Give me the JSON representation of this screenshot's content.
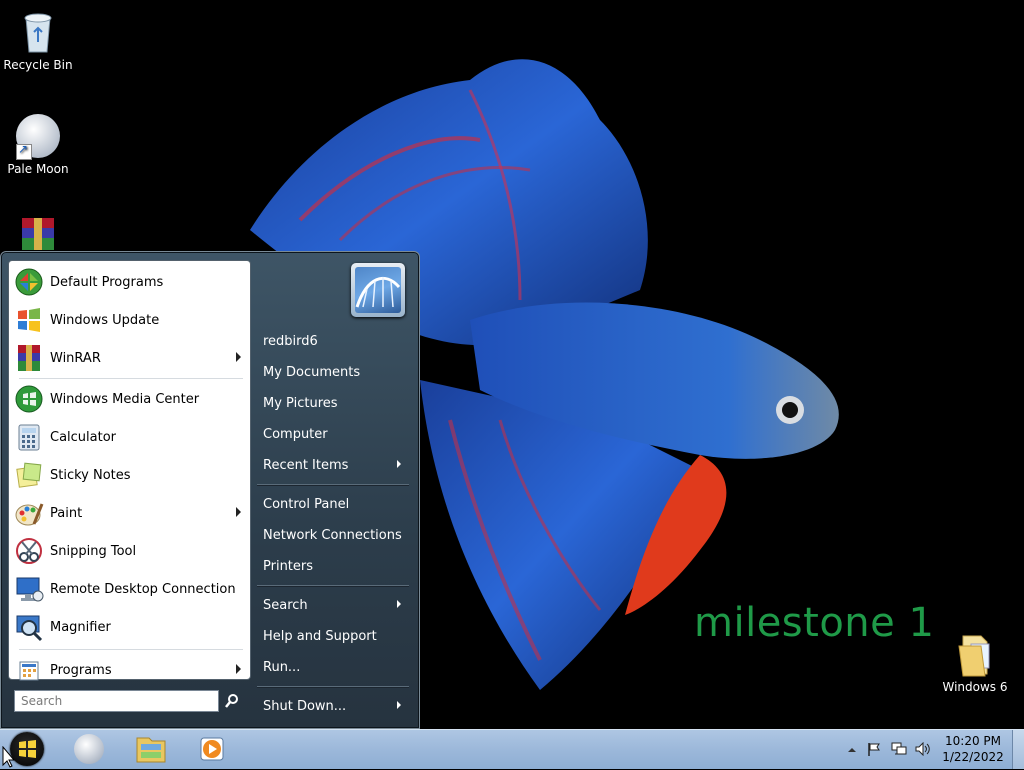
{
  "desktop": {
    "icons": [
      {
        "label": "Recycle Bin",
        "icon": "recycle-bin-icon"
      },
      {
        "label": "Pale Moon",
        "icon": "pale-moon-icon"
      },
      {
        "label": "",
        "icon": "winrar-icon"
      },
      {
        "label": "Windows 6",
        "icon": "folder-icon"
      }
    ],
    "watermark": "milestone 1"
  },
  "start_menu": {
    "programs": [
      {
        "label": "Default Programs",
        "icon": "default-programs-icon",
        "submenu": false
      },
      {
        "label": "Windows Update",
        "icon": "windows-update-icon",
        "submenu": false
      },
      {
        "label": "WinRAR",
        "icon": "winrar-icon",
        "submenu": true
      },
      {
        "label": "Windows Media Center",
        "icon": "media-center-icon",
        "submenu": false
      },
      {
        "label": "Calculator",
        "icon": "calculator-icon",
        "submenu": false
      },
      {
        "label": "Sticky Notes",
        "icon": "sticky-notes-icon",
        "submenu": false
      },
      {
        "label": "Paint",
        "icon": "paint-icon",
        "submenu": true
      },
      {
        "label": "Snipping Tool",
        "icon": "snipping-tool-icon",
        "submenu": false
      },
      {
        "label": "Remote Desktop Connection",
        "icon": "remote-desktop-icon",
        "submenu": false
      },
      {
        "label": "Magnifier",
        "icon": "magnifier-icon",
        "submenu": false
      }
    ],
    "all_programs_label": "Programs",
    "search_placeholder": "Search",
    "right_items": [
      {
        "label": "redbird6",
        "submenu": false
      },
      {
        "label": "My Documents",
        "submenu": false
      },
      {
        "label": "My Pictures",
        "submenu": false
      },
      {
        "label": "Computer",
        "submenu": false
      },
      {
        "label": "Recent Items",
        "submenu": true
      },
      {
        "label": "Control Panel",
        "submenu": false
      },
      {
        "label": "Network Connections",
        "submenu": false
      },
      {
        "label": "Printers",
        "submenu": false
      },
      {
        "label": "Search",
        "submenu": true
      },
      {
        "label": "Help and Support",
        "submenu": false
      },
      {
        "label": "Run...",
        "submenu": false
      },
      {
        "label": "Shut Down...",
        "submenu": true
      }
    ]
  },
  "taskbar": {
    "pinned": [
      "pale-moon-icon",
      "file-explorer-icon",
      "media-player-icon"
    ],
    "tray_icons": [
      "show-hidden-icons-icon",
      "action-center-flag-icon",
      "network-icon",
      "volume-icon"
    ],
    "clock_time": "10:20 PM",
    "clock_date": "1/22/2022"
  },
  "colors": {
    "menu_bg": "#2c3d4b",
    "watermark": "#1f9a48",
    "taskbar": "#9cb8da"
  }
}
